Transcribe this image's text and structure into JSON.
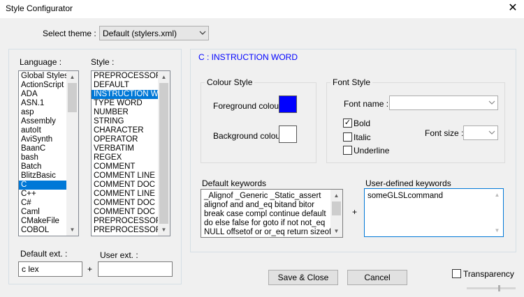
{
  "window": {
    "title": "Style Configurator",
    "close_glyph": "✕"
  },
  "theme": {
    "label": "Select theme :",
    "value": "Default (stylers.xml)"
  },
  "language": {
    "label": "Language :",
    "items": [
      "Global Styles",
      "ActionScript",
      "ADA",
      "ASN.1",
      "asp",
      "Assembly",
      "autoIt",
      "AviSynth",
      "BaanC",
      "bash",
      "Batch",
      "BlitzBasic",
      "C",
      "C++",
      "C#",
      "Caml",
      "CMakeFile",
      "COBOL"
    ],
    "selected": "C"
  },
  "style": {
    "label": "Style :",
    "items": [
      "PREPROCESSOR",
      "DEFAULT",
      "INSTRUCTION WORD",
      "TYPE WORD",
      "NUMBER",
      "STRING",
      "CHARACTER",
      "OPERATOR",
      "VERBATIM",
      "REGEX",
      "COMMENT",
      "COMMENT LINE",
      "COMMENT DOC",
      "COMMENT LINE DOC",
      "COMMENT DOC KEYWORD",
      "COMMENT DOC KEYWORD ERROR",
      "PREPROCESSOR COMMENT",
      "PREPROCESSOR COMMENT DOC"
    ],
    "selected": "INSTRUCTION WORD"
  },
  "ext": {
    "default_label": "Default ext. :",
    "default_value": "c lex",
    "plus": "+",
    "user_label": "User ext. :",
    "user_value": ""
  },
  "panel": {
    "heading": "C : INSTRUCTION WORD",
    "heading_color": "#0000ff"
  },
  "colour_style": {
    "label": "Colour Style",
    "fg_label": "Foreground colour",
    "fg_color": "#0000ff",
    "bg_label": "Background colour",
    "bg_color": "#ffffff"
  },
  "font_style": {
    "label": "Font Style",
    "name_label": "Font name :",
    "name_value": "",
    "bold_label": "Bold",
    "bold_checked": true,
    "italic_label": "Italic",
    "italic_checked": false,
    "underline_label": "Underline",
    "underline_checked": false,
    "size_label": "Font size :",
    "size_value": ""
  },
  "keywords": {
    "default_label": "Default keywords",
    "default_lines": [
      "_Alignof _Generic _Static_assert",
      "alignof and and_eq bitand bitor",
      "break case compl continue default",
      "do else false for goto if not not_eq",
      "NULL offsetof or or_eq return sizeof"
    ],
    "plus": "+",
    "user_label": "User-defined keywords",
    "user_value": "someGLSLcommand"
  },
  "buttons": {
    "save": "Save & Close",
    "cancel": "Cancel"
  },
  "transparency": {
    "label": "Transparency",
    "checked": false
  }
}
